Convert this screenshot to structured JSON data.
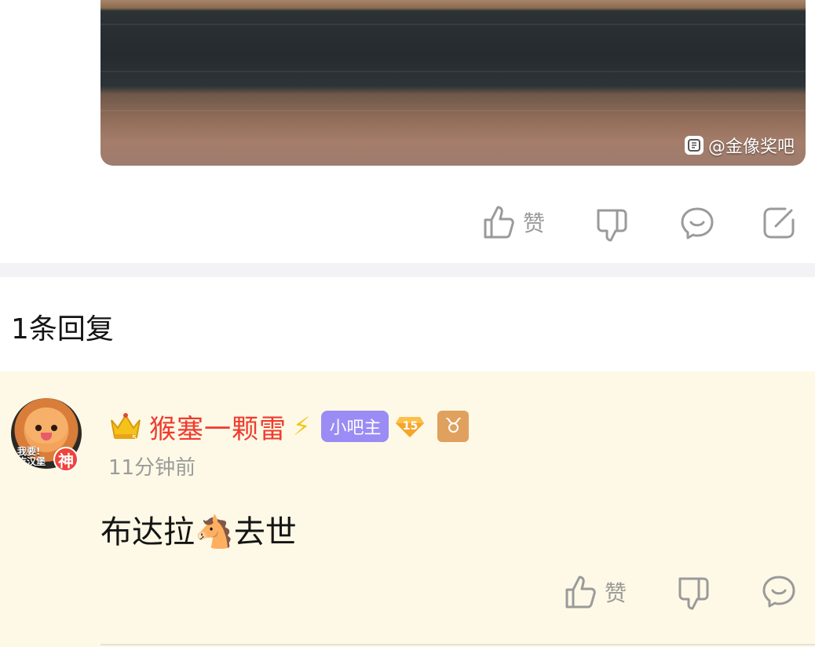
{
  "post": {
    "image_watermark": "@金像奖吧",
    "actions": {
      "like_label": "赞"
    }
  },
  "replies_section": {
    "count_label": "1条回复"
  },
  "reply": {
    "avatar_caption_line1": "我要!",
    "avatar_caption_line2": "吃汉堡",
    "god_badge": "神",
    "username": "猴塞一颗雷",
    "role_badge": "小吧主",
    "level": "15",
    "zodiac_symbol": "♉",
    "timestamp": "11分钟前",
    "content_before": "布达拉",
    "content_emoji": "🐴",
    "content_after": "去世",
    "actions": {
      "like_label": "赞"
    }
  },
  "colors": {
    "username": "#f03b2e",
    "role_badge_bg": "#9b8bf5",
    "reply_bg": "#fdf9e6",
    "icon_gray": "#9a9a9a"
  }
}
